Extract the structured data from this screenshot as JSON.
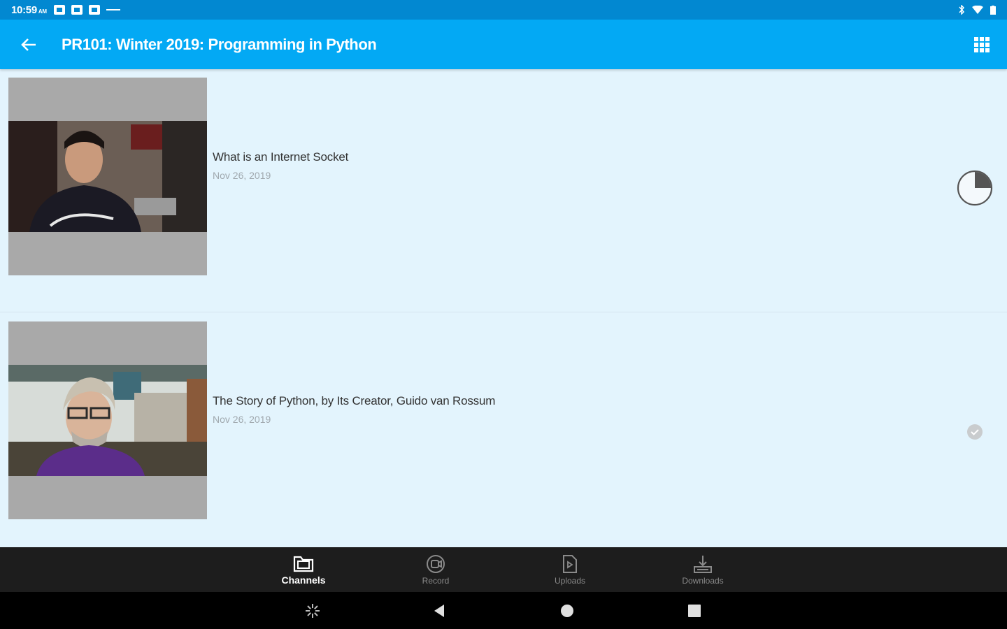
{
  "status_bar": {
    "time": "10:59",
    "ampm": "AM"
  },
  "app_bar": {
    "title": "PR101: Winter 2019: Programming in Python",
    "back_icon": "arrow-back-icon",
    "menu_icon": "apps-grid-icon"
  },
  "videos": [
    {
      "title": "What is an Internet Socket",
      "date": "Nov 26, 2019",
      "status": "in-progress",
      "progress": 0.25,
      "status_icon": "progress-pie-icon"
    },
    {
      "title": "The Story of Python, by Its Creator, Guido van Rossum",
      "date": "Nov 26, 2019",
      "status": "complete",
      "status_icon": "check-circle-icon"
    }
  ],
  "bottom_nav": {
    "items": [
      {
        "label": "Channels",
        "icon": "channels-icon",
        "active": true
      },
      {
        "label": "Record",
        "icon": "record-icon",
        "active": false
      },
      {
        "label": "Uploads",
        "icon": "uploads-icon",
        "active": false
      },
      {
        "label": "Downloads",
        "icon": "downloads-icon",
        "active": false
      }
    ]
  },
  "colors": {
    "app_bar": "#03a9f4",
    "status_bar": "#0288d1",
    "list_bg": "#e3f4fd",
    "bottom_nav": "#1d1d1d"
  }
}
